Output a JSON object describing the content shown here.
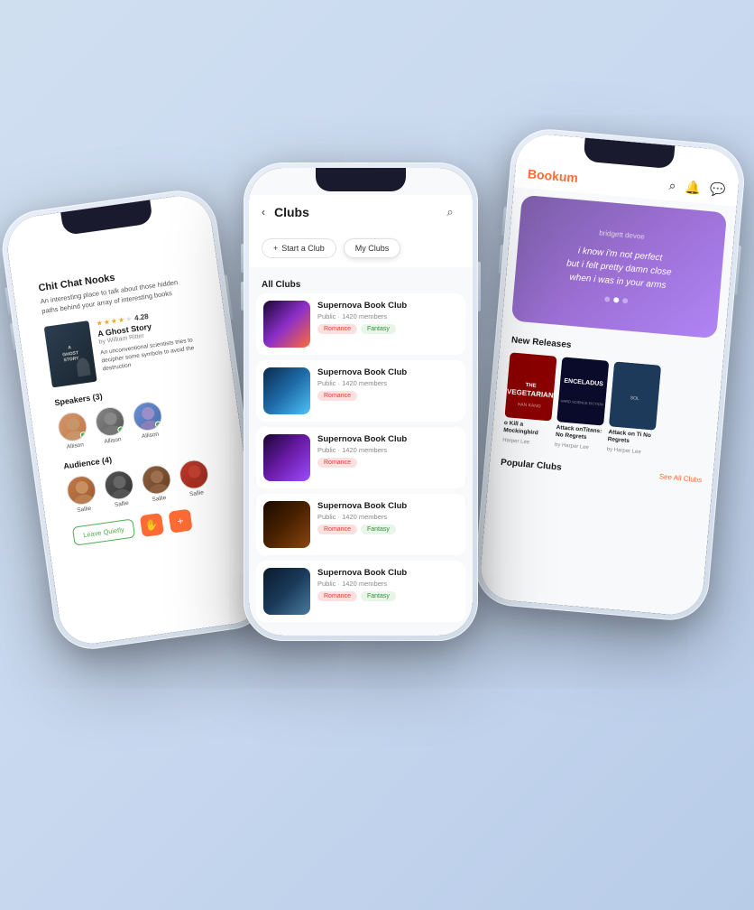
{
  "phones": {
    "left": {
      "title": "Chit Chat Nooks",
      "subtitle": "An interesting place to talk about those hidden paths behind your array of interesting books",
      "book": {
        "title": "A Ghost Story",
        "author": "by William Ritter",
        "rating": "4.28",
        "description": "An unconventional scientists tries to decipher some symbols to avoid the destruction"
      },
      "speakers_section": "Speakers (3)",
      "speakers": [
        {
          "name": "Allison"
        },
        {
          "name": "Allison"
        },
        {
          "name": "Allison"
        }
      ],
      "audience_section": "Audience (4)",
      "audience": [
        {
          "name": "Sallie"
        },
        {
          "name": "Sallie"
        },
        {
          "name": "Sallie"
        },
        {
          "name": "Sallie"
        }
      ],
      "leave_button": "Leave Quietly"
    },
    "middle": {
      "back_label": "‹",
      "title": "Clubs",
      "start_club": "Start a Club",
      "my_clubs": "My Clubs",
      "all_clubs_label": "All Clubs",
      "clubs": [
        {
          "name": "Supernova Book Club",
          "meta": "Public · 1420 members",
          "tags": [
            "Romance",
            "Fantasy"
          ],
          "cover": 1
        },
        {
          "name": "Supernova Book Club",
          "meta": "Public · 1420 members",
          "tags": [
            "Romance"
          ],
          "cover": 2
        },
        {
          "name": "Supernova Book Club",
          "meta": "Public · 1420 members",
          "tags": [
            "Romance"
          ],
          "cover": 3
        },
        {
          "name": "Supernova Book Club",
          "meta": "Public · 1420 members",
          "tags": [
            "Romance",
            "Fantasy"
          ],
          "cover": 4
        },
        {
          "name": "Supernova Book Club",
          "meta": "Public · 1420 members",
          "tags": [
            "Romance",
            "Fantasy"
          ],
          "cover": 5
        }
      ]
    },
    "right": {
      "logo": "Bookum",
      "banner": {
        "author": "bridgett devoe",
        "quote": "i know i'm not perfect\nbut i felt pretty damn close\nwhen i was in your arms"
      },
      "new_releases": "New Releases",
      "popular_clubs": "Popular Clubs",
      "see_all": "See All Clubs",
      "books": [
        {
          "title": "o Kill a Mockingbird",
          "author": "Harper Lee",
          "cover": "r1"
        },
        {
          "title": "Attack onTitans: No Regrets",
          "author": "by Harper Lee",
          "cover": "r2"
        },
        {
          "title": "Attack on Ti No Regrets",
          "author": "by Harper Lee",
          "cover": "r3"
        }
      ]
    }
  }
}
